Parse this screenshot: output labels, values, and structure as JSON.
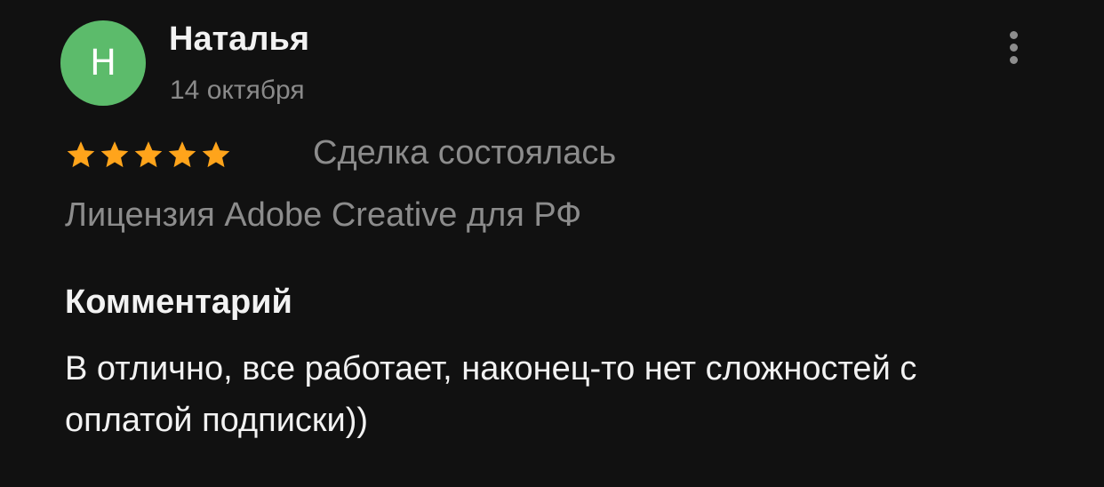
{
  "review": {
    "avatar_letter": "Н",
    "author_name": "Наталья",
    "date": "14 октября",
    "rating": 5,
    "rating_max": 5,
    "deal_status": "Сделка состоялась",
    "product": "Лицензия Adobe Creative для РФ",
    "comment_heading": "Комментарий",
    "comment_text": "В отлично, все работает, наконец-то нет сложностей с оплатой подписки))"
  },
  "icons": {
    "more": "more-vertical-icon",
    "star": "star-icon"
  },
  "colors": {
    "background": "#111111",
    "avatar": "#5cbb6b",
    "star": "#ffa41b",
    "primary_text": "#f2f2f2",
    "secondary_text": "#8c8c8c"
  }
}
